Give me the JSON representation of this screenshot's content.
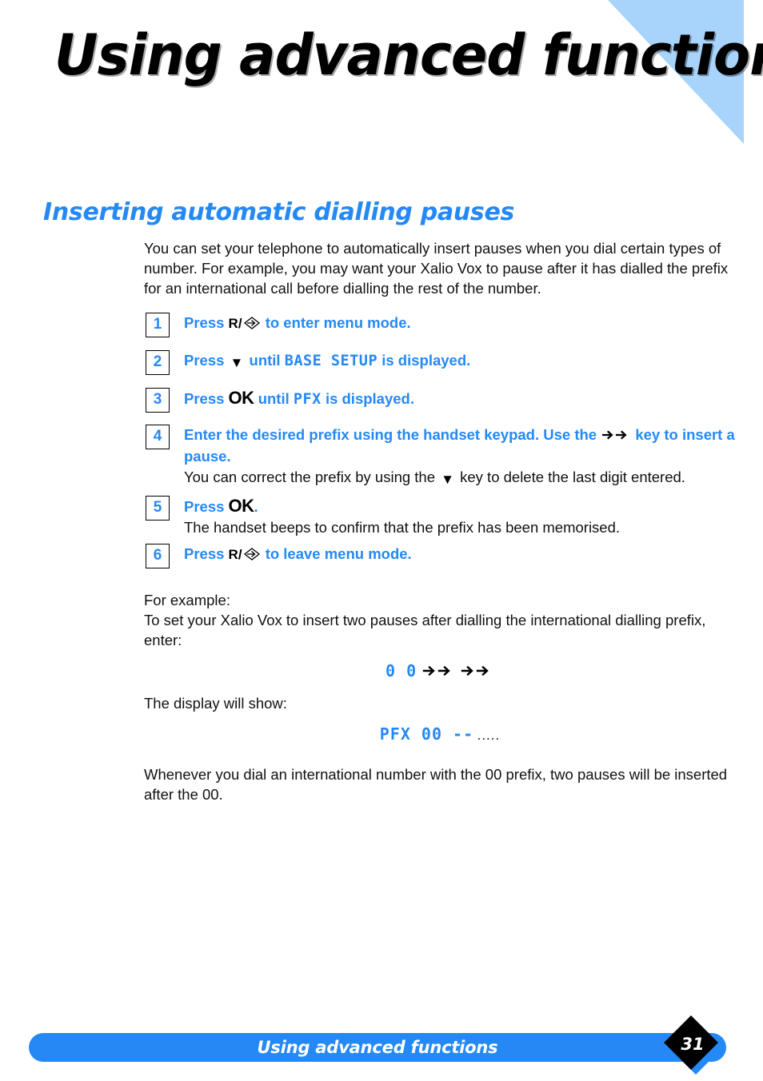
{
  "header": {
    "title": "Using advanced functions",
    "triangle_color": "#a8d3fb"
  },
  "section": {
    "heading": "Inserting automatic dialling pauses",
    "heading_color": "#2589f5"
  },
  "intro": {
    "paragraph": "You can set your telephone to automatically insert pauses when you dial certain types of number.  For example, you may want your Xalio Vox to pause after it has dialled the prefix for an international call before dialling the rest of the number."
  },
  "steps": [
    {
      "number": "1",
      "text_before": "Press",
      "key_label": "R/",
      "key_icon": "flash-diamond-icon",
      "text_after": "to enter menu mode."
    },
    {
      "number": "2",
      "text_before": "Press",
      "key_icon": "down-arrow-icon",
      "text_mid": "until",
      "display_value": "BASE SETUP",
      "text_after": "is displayed."
    },
    {
      "number": "3",
      "text_before": "Press",
      "key_label": "OK",
      "text_mid": "until",
      "display_value": "PFX",
      "text_after": "is displayed."
    },
    {
      "number": "4",
      "text_before": "Enter the desired prefix using the handset keypad.  Use the",
      "key_icon": "double-right-arrow-icon",
      "text_after": "key to insert a pause.",
      "sub_before": "You can correct the prefix by using the",
      "sub_icon": "down-arrow-icon",
      "sub_after": "key to delete the last digit entered."
    },
    {
      "number": "5",
      "text_before": "Press",
      "key_label": "OK",
      "text_after": ".",
      "sub_text": "The handset beeps to confirm that the prefix has been memorised."
    },
    {
      "number": "6",
      "text_before": "Press",
      "key_label": "R/",
      "key_icon": "flash-diamond-icon",
      "text_after": "to leave menu mode."
    }
  ],
  "example": {
    "label": "For example:",
    "description": "To set your Xalio Vox to insert two pauses after dialling the international dialling prefix, enter:",
    "keypress_digits": "0 0",
    "keypress_pause_count": 2,
    "display_label": "The display will show:",
    "display_code": "PFX 00 --",
    "display_dots": ".....",
    "closing": "Whenever you dial an international number with the 00 prefix, two pauses will be inserted after the 00."
  },
  "footer": {
    "title": "Using advanced functions",
    "page_number": "31",
    "bar_color": "#2589f5",
    "badge_color": "#000000"
  }
}
